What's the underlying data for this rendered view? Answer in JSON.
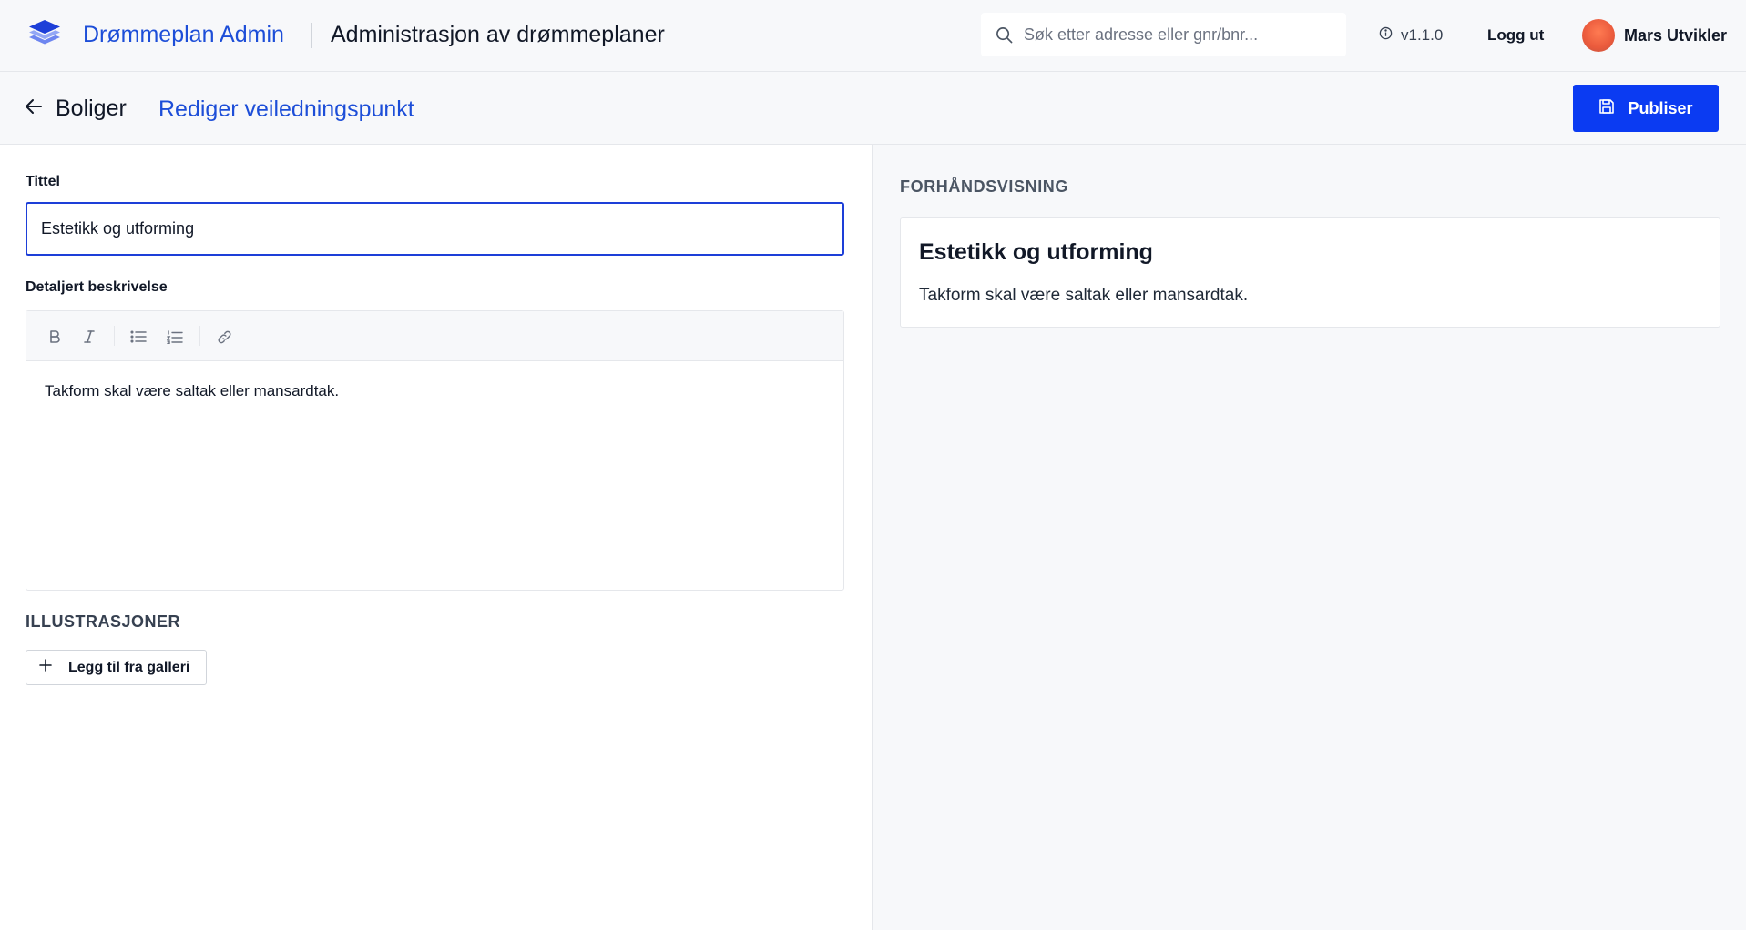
{
  "header": {
    "brand": "Drømmeplan Admin",
    "subtitle": "Administrasjon av drømmeplaner",
    "search": {
      "placeholder": "Søk etter adresse eller gnr/bnr...",
      "value": "",
      "icon": "search-icon"
    },
    "version": "v1.1.0",
    "logout_label": "Logg ut",
    "user": {
      "name": "Mars Utvikler"
    }
  },
  "subheader": {
    "back_label": "Boliger",
    "page_title": "Rediger veiledningspunkt",
    "publish_label": "Publiser"
  },
  "form": {
    "title_label": "Tittel",
    "title_value": "Estetikk og utforming",
    "description_label": "Detaljert beskrivelse",
    "toolbar": [
      "bold-icon",
      "italic-icon",
      "bullet-list-icon",
      "numbered-list-icon",
      "link-icon"
    ],
    "description_value": "Takform skal være saltak eller mansardtak.",
    "illustrations_label": "ILLUSTRASJONER",
    "add_from_gallery_label": "Legg til fra galleri"
  },
  "preview": {
    "label": "FORHÅNDSVISNING",
    "title": "Estetikk og utforming",
    "text": "Takform skal være saltak eller mansardtak."
  },
  "colors": {
    "brand": "#1d4ed8",
    "primary_button": "#0b3bf2",
    "focus_border": "#1d3fd8",
    "header_bg": "#f7f8fa"
  }
}
